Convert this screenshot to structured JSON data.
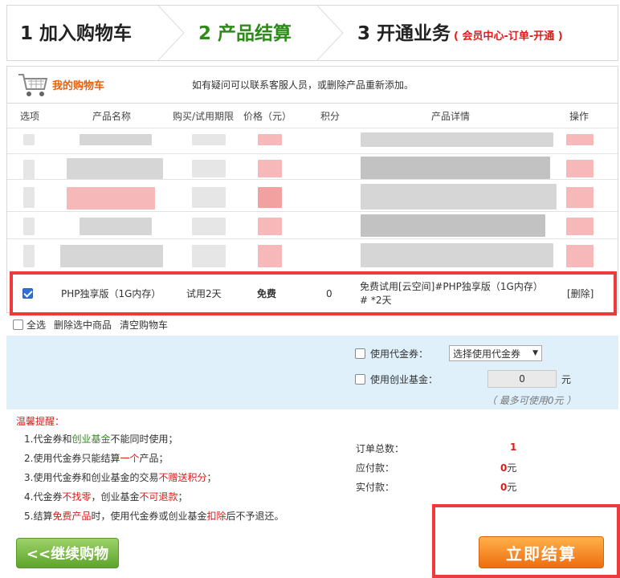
{
  "steps": [
    {
      "label": "1 加入购物车"
    },
    {
      "label": "2 产品结算"
    },
    {
      "label": "3 开通业务",
      "sub": "( 会员中心-订单-开通 )"
    }
  ],
  "colors": {
    "accent_green": "#2e8b1a",
    "accent_red": "#e01b1b",
    "cart_orange": "#e8600a",
    "highlight_border": "#ee3a3a"
  },
  "cart": {
    "title": "我的购物车",
    "tip": "如有疑问可以联系客服人员，或删除产品重新添加。",
    "icon": "shopping-cart-icon"
  },
  "table": {
    "headers": [
      "选项",
      "产品名称",
      "购买/试用期限",
      "价格（元）",
      "积分",
      "产品详情",
      "操作"
    ],
    "selected_row": {
      "checked": true,
      "name": "PHP独享版（1G内存）",
      "period": "试用2天",
      "price": "免费",
      "points": "0",
      "detail_line1": "免费试用[云空间]#PHP独享版（1G内存）",
      "detail_line2": "# *2天",
      "action": "[删除]"
    }
  },
  "actions": {
    "select_all": "全选",
    "delete_selected": "删除选中商品",
    "clear_cart": "清空购物车"
  },
  "voucher": {
    "use_voucher_label": "使用代金券：",
    "voucher_select": "选择使用代金券",
    "use_fund_label": "使用创业基金：",
    "fund_amount": "0",
    "fund_unit": "元",
    "max_note": "（ 最多可使用0元 ）"
  },
  "tips": {
    "title": "温馨提醒：",
    "items": [
      {
        "a": "1.代金券和",
        "g": "创业基金",
        "b": "不能同时使用；"
      },
      {
        "a": "2.使用代金券只能结算",
        "r": "一个",
        "b": "产品；"
      },
      {
        "a": "3.使用代金券和创业基金的交易",
        "r": "不赠送积分",
        "b": "；"
      },
      {
        "a": "4.代金券",
        "r": "不找零",
        "b": "，创业基金",
        "r2": "不可退款",
        "c": "；"
      },
      {
        "a": "5.结算",
        "r": "免费产品",
        "b": "时，使用代金券或创业基金",
        "r2": "扣除",
        "c": "后不予退还。"
      }
    ]
  },
  "summary": {
    "total_count_label": "订单总数：",
    "total_count": "1",
    "payable_label": "应付款：",
    "payable": "0",
    "paid_label": "实付款：",
    "paid": "0",
    "unit": "元"
  },
  "buttons": {
    "continue": "<<继续购物",
    "checkout": "立即结算"
  }
}
